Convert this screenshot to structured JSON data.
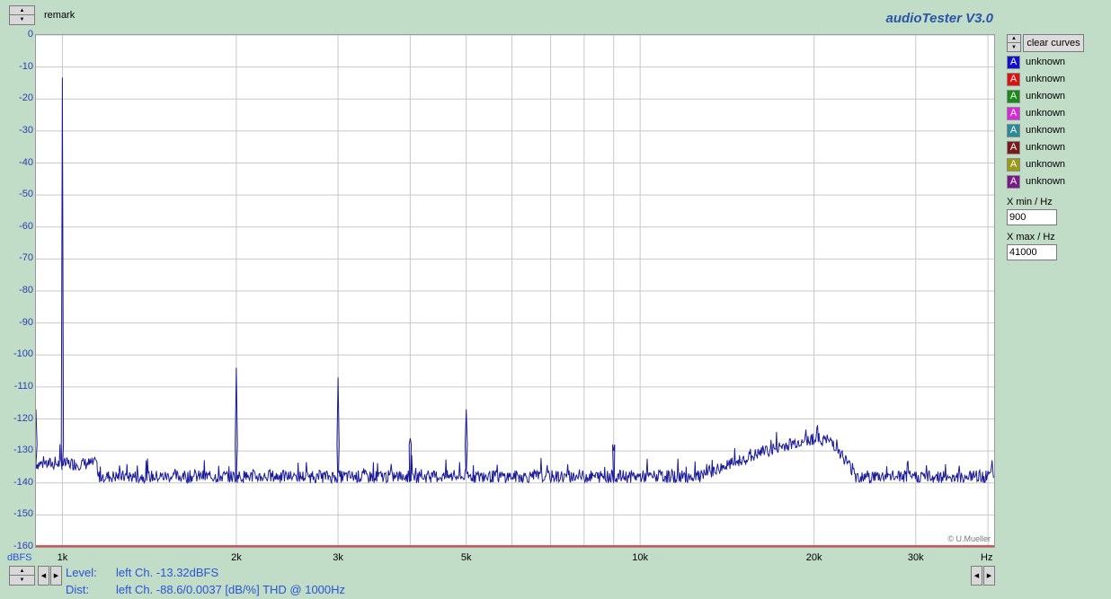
{
  "app": {
    "title": "audioTester  V3.0",
    "remark_label": "remark",
    "copyright": "© U.Mueller"
  },
  "sidebar": {
    "clear_label": "clear curves",
    "curve_glyph": "A",
    "curves": [
      {
        "name": "unknown",
        "color": "#1010d0"
      },
      {
        "name": "unknown",
        "color": "#e01010"
      },
      {
        "name": "unknown",
        "color": "#1a8a1a"
      },
      {
        "name": "unknown",
        "color": "#d828d8"
      },
      {
        "name": "unknown",
        "color": "#2a8a9a"
      },
      {
        "name": "unknown",
        "color": "#7a1a1a"
      },
      {
        "name": "unknown",
        "color": "#9a9a18"
      },
      {
        "name": "unknown",
        "color": "#7a1a8a"
      }
    ],
    "xmin_label": "X min / Hz",
    "xmin_value": "900",
    "xmax_label": "X max / Hz",
    "xmax_value": "41000"
  },
  "status": {
    "level_label": "Level:",
    "level_value": "left Ch. -13.32dBFS",
    "dist_label": "Dist:",
    "dist_value": "left Ch. -88.6/0.0037 [dB/%] THD @ 1000Hz"
  },
  "chart_data": {
    "type": "line",
    "xscale": "log",
    "xlim": [
      900,
      41000
    ],
    "ylim": [
      -160,
      0
    ],
    "ylabel": "dBFS",
    "xlabel": "Hz",
    "y_ticks": [
      "0",
      "-10",
      "-20",
      "-30",
      "-40",
      "-50",
      "-60",
      "-70",
      "-80",
      "-90",
      "-100",
      "-110",
      "-120",
      "-130",
      "-140",
      "-150",
      "-160"
    ],
    "x_ticks": [
      {
        "label": "1k",
        "value": 1000
      },
      {
        "label": "2k",
        "value": 2000
      },
      {
        "label": "3k",
        "value": 3000
      },
      {
        "label": "5k",
        "value": 5000
      },
      {
        "label": "10k",
        "value": 10000
      },
      {
        "label": "20k",
        "value": 20000
      },
      {
        "label": "30k",
        "value": 30000
      }
    ],
    "grid": true,
    "series": [
      {
        "color": "#1a1a9a",
        "noise_floor": -138,
        "peaks": [
          {
            "x": 900,
            "y": -117
          },
          {
            "x": 1000,
            "y": -13.3
          },
          {
            "x": 2000,
            "y": -104
          },
          {
            "x": 3000,
            "y": -107
          },
          {
            "x": 4000,
            "y": -126
          },
          {
            "x": 5000,
            "y": -117
          },
          {
            "x": 9000,
            "y": -130
          }
        ],
        "hump": [
          {
            "x": 13000,
            "y": -137
          },
          {
            "x": 16000,
            "y": -131
          },
          {
            "x": 18000,
            "y": -128
          },
          {
            "x": 20000,
            "y": -126
          },
          {
            "x": 21500,
            "y": -127
          },
          {
            "x": 22500,
            "y": -132
          },
          {
            "x": 23500,
            "y": -137
          }
        ]
      }
    ]
  }
}
